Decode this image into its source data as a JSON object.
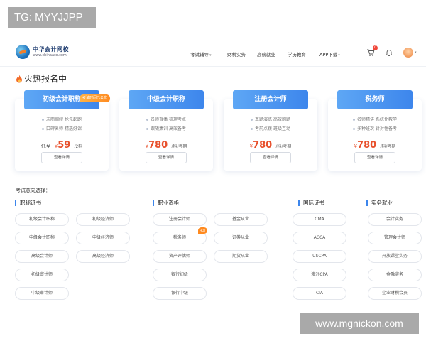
{
  "watermarks": {
    "top": "TG: MYYJJPP",
    "bottom": "www.mgnickon.com"
  },
  "header": {
    "logo_name": "中华会计网校",
    "logo_url": "www.chinaacc.com",
    "nav": [
      "考试辅导",
      "财税实务",
      "高薪就业",
      "学历教育",
      "APP下载"
    ],
    "cart_count": "0",
    "icons": [
      "cart-icon",
      "bell-icon",
      "avatar"
    ]
  },
  "hot": {
    "title": "火热报名中",
    "cards": [
      {
        "name": "初级会计职称",
        "tag": "考试时间已公布",
        "line1": "未雨绸缪 抢先起跑",
        "line2": "口碑名师 精选好课",
        "price_prefix": "低至",
        "currency": "¥",
        "price": "59",
        "unit": "/2科",
        "button": "查看详情"
      },
      {
        "name": "中级会计职称",
        "tag": "",
        "line1": "名师直播 梳理考点",
        "line2": "跟随集训 高效备考",
        "price_prefix": "",
        "currency": "¥",
        "price": "780",
        "unit": "/科/考期",
        "button": "查看详情"
      },
      {
        "name": "注册会计师",
        "tag": "",
        "line1": "真题演练 高效刷题",
        "line2": "考前点拨 班级互动",
        "price_prefix": "",
        "currency": "¥",
        "price": "780",
        "unit": "/科/考期",
        "button": "查看详情"
      },
      {
        "name": "税务师",
        "tag": "",
        "line1": "名师精讲 系统化教学",
        "line2": "多种班次 针对性备考",
        "price_prefix": "",
        "currency": "¥",
        "price": "780",
        "unit": "/科/考期",
        "button": "查看详情"
      }
    ]
  },
  "direction": {
    "title": "考试意向选择：",
    "columns": [
      {
        "head": "职称证书",
        "items": [
          "初级会计职称",
          "初级经济师",
          "中级会计职称",
          "中级经济师",
          "高级会计师",
          "高级经济师",
          "初级审计师",
          "中级审计师"
        ]
      },
      {
        "head": "职业资格",
        "items": [
          "注册会计师",
          "基金从业",
          "税务师",
          "证券从业",
          "资产评估师",
          "期货从业",
          "银行初级",
          "银行中级"
        ],
        "hot_label": "HOT"
      },
      {
        "head": "国际证书",
        "items": [
          "CMA",
          "ACCA",
          "USCPA",
          "澳洲CPA",
          "CIA"
        ]
      },
      {
        "head": "实务就业",
        "items": [
          "会计实务",
          "管理会计师",
          "开放课堂实务",
          "金融实务",
          "企业财税会员"
        ]
      }
    ]
  },
  "colors": {
    "accent": "#3d86ec",
    "price": "#e8502c",
    "tag": "#ff8a1f"
  }
}
